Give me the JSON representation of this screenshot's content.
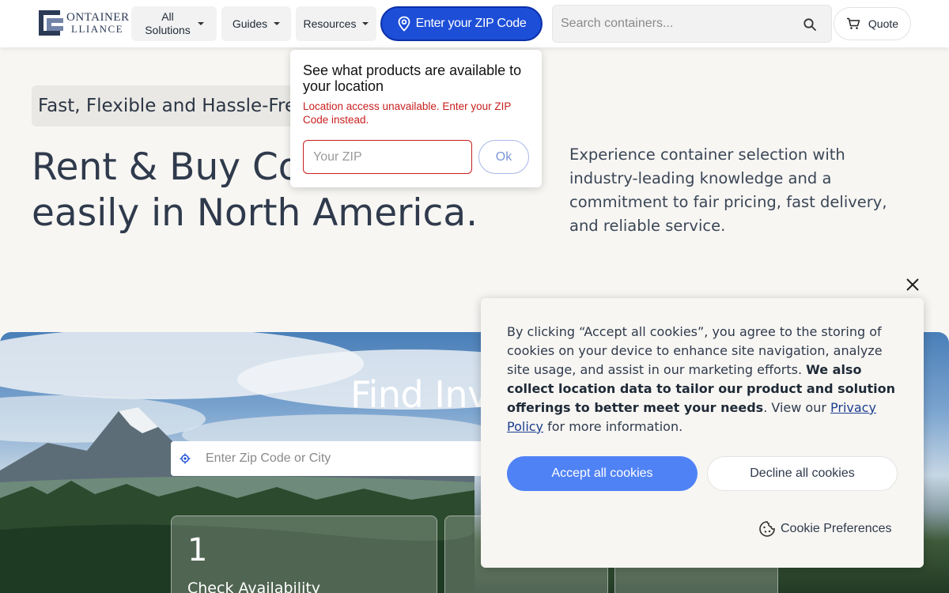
{
  "header": {
    "logo": {
      "line1": "ONTAINER",
      "line2": "LLIANCE",
      "alt": "Container Alliance"
    },
    "nav": {
      "all_solutions": "All Solutions",
      "guides": "Guides",
      "resources": "Resources"
    },
    "zip_button": "Enter your ZIP Code",
    "search": {
      "placeholder": "Search containers..."
    },
    "quote": "Quote"
  },
  "zip_popover": {
    "title": "See what products are available to your location",
    "error": "Location access unavailable. Enter your ZIP Code instead.",
    "input_placeholder": "Your ZIP",
    "ok": "Ok"
  },
  "hero": {
    "tagline": "Fast, Flexible and Hassle-Free",
    "headline_line1": "Rent & Buy Co",
    "headline_line2": "easily in North America.",
    "subtext": "Experience container selection with industry-leading knowledge and a commitment to fair pricing, fast delivery, and reliable service."
  },
  "banner": {
    "title": "Find Inv",
    "location_placeholder": "Enter Zip Code or City",
    "steps": [
      {
        "number": "1",
        "title": "Check Availability"
      }
    ]
  },
  "cookie_banner": {
    "text_1": "By clicking “Accept all cookies”, you agree to the storing of cookies on your device to enhance site navigation, analyze site usage, and assist in our marketing efforts. ",
    "text_bold": "We also collect location data to tailor our product and solution offerings to better meet your needs",
    "text_2": ". View our ",
    "privacy_link": "Privacy Policy",
    "text_3": " for more information.",
    "accept": "Accept all cookies",
    "decline": "Decline all cookies",
    "preferences": "Cookie Preferences"
  },
  "colors": {
    "primary_blue": "#1d4ed8",
    "accept_blue": "#4f82f5",
    "error_red": "#c81e1e",
    "text_dark": "#2f3a4c",
    "page_bg": "#f7f6f3"
  }
}
